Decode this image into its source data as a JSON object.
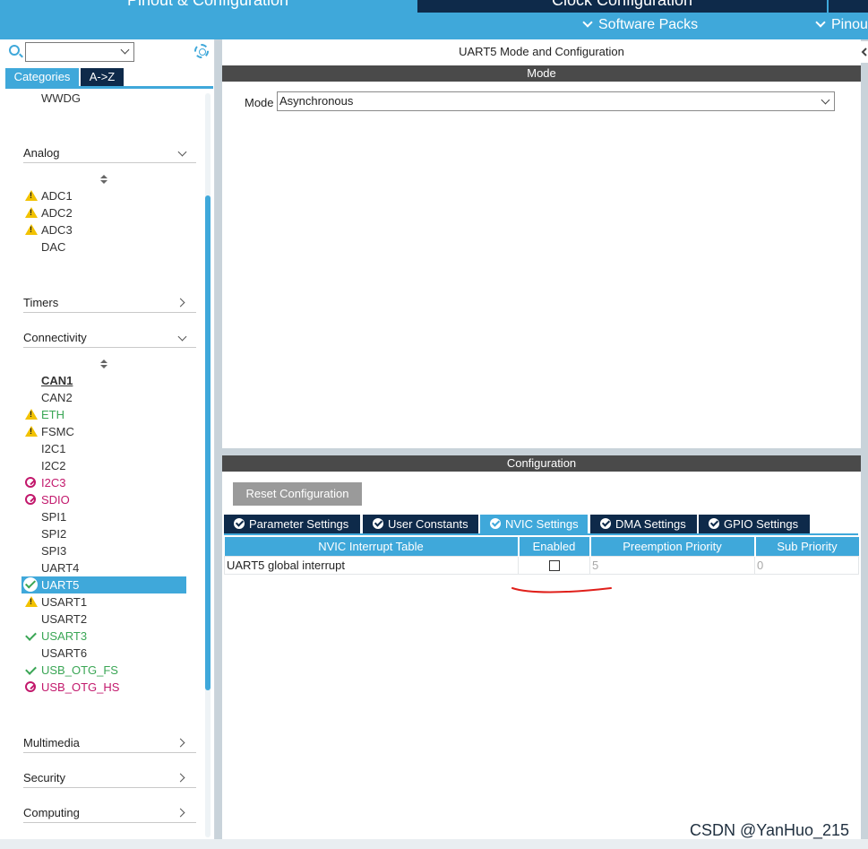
{
  "top_tabs": {
    "pinout_config": "Pinout & Configuration",
    "clock_config": "Clock Configuration",
    "software_packs": "Software Packs",
    "pinout_short": "Pinou"
  },
  "left": {
    "search_value": "",
    "tab_categories": "Categories",
    "tab_az": "A->Z",
    "top_item": "WWDG",
    "categories": {
      "analog": "Analog",
      "timers": "Timers",
      "connectivity": "Connectivity",
      "multimedia": "Multimedia",
      "security": "Security",
      "computing": "Computing"
    },
    "analog_items": [
      {
        "label": "ADC1",
        "status": "warning"
      },
      {
        "label": "ADC2",
        "status": "warning"
      },
      {
        "label": "ADC3",
        "status": "warning"
      },
      {
        "label": "DAC",
        "status": "none"
      }
    ],
    "connectivity_items": [
      {
        "label": "CAN1",
        "status": "none"
      },
      {
        "label": "CAN2",
        "status": "none"
      },
      {
        "label": "ETH",
        "status": "warning"
      },
      {
        "label": "FSMC",
        "status": "warning"
      },
      {
        "label": "I2C1",
        "status": "none"
      },
      {
        "label": "I2C2",
        "status": "none"
      },
      {
        "label": "I2C3",
        "status": "blocked"
      },
      {
        "label": "SDIO",
        "status": "blocked"
      },
      {
        "label": "SPI1",
        "status": "none"
      },
      {
        "label": "SPI2",
        "status": "none"
      },
      {
        "label": "SPI3",
        "status": "none"
      },
      {
        "label": "UART4",
        "status": "none"
      },
      {
        "label": "UART5",
        "status": "selected-ok"
      },
      {
        "label": "USART1",
        "status": "warning"
      },
      {
        "label": "USART2",
        "status": "none"
      },
      {
        "label": "USART3",
        "status": "ok"
      },
      {
        "label": "USART6",
        "status": "none"
      },
      {
        "label": "USB_OTG_FS",
        "status": "ok"
      },
      {
        "label": "USB_OTG_HS",
        "status": "blocked"
      }
    ]
  },
  "right": {
    "panel_title": "UART5 Mode and Configuration",
    "mode_section": "Mode",
    "mode_label": "Mode",
    "mode_value": "Asynchronous",
    "config_section": "Configuration",
    "reset_button": "Reset Configuration",
    "tabs": [
      "Parameter Settings",
      "User Constants",
      "NVIC Settings",
      "DMA Settings",
      "GPIO Settings"
    ],
    "active_tab": "NVIC Settings",
    "table": {
      "headers": [
        "NVIC Interrupt Table",
        "Enabled",
        "Preemption Priority",
        "Sub Priority"
      ],
      "rows": [
        {
          "name": "UART5 global interrupt",
          "enabled": false,
          "preemption": "5",
          "sub": "0"
        }
      ]
    }
  },
  "watermark": "CSDN @YanHuo_215",
  "colors": {
    "accent": "#3fa8da",
    "dark_navy": "#0e2a4a",
    "ok_green": "#3aa655",
    "warning_yellow": "#f2c200",
    "blocked_magenta": "#c2186c",
    "annotation_red": "#e0201b"
  }
}
